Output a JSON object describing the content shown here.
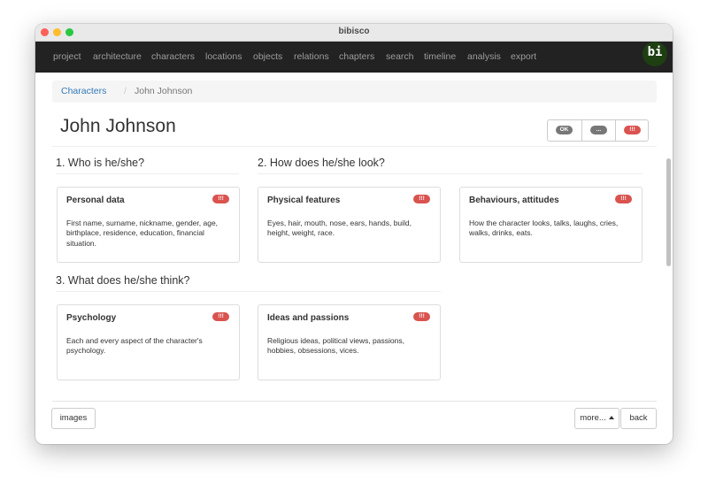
{
  "window": {
    "title": "bibisco"
  },
  "nav": {
    "items": [
      "project",
      "architecture",
      "characters",
      "locations",
      "objects",
      "relations",
      "chapters",
      "search",
      "timeline",
      "analysis",
      "export"
    ],
    "logo_text": "bi"
  },
  "breadcrumb": {
    "parent": "Characters",
    "separator": "/",
    "current": "John Johnson"
  },
  "page": {
    "title": "John Johnson"
  },
  "status_buttons": {
    "ok": "OK",
    "dots": "...",
    "danger": "!!!"
  },
  "sections": [
    {
      "heading": "1. Who is he/she?"
    },
    {
      "heading": "2. How does he/she look?"
    },
    {
      "heading": "3. What does he/she think?"
    }
  ],
  "cards": [
    {
      "title": "Personal data",
      "badge": "!!!",
      "description": "First name, surname, nickname, gender, age, birthplace, residence, education, financial situation."
    },
    {
      "title": "Physical features",
      "badge": "!!!",
      "description": "Eyes, hair, mouth, nose, ears, hands, build, height, weight, race."
    },
    {
      "title": "Behaviours, attitudes",
      "badge": "!!!",
      "description": "How the character looks, talks, laughs, cries, walks, drinks, eats."
    },
    {
      "title": "Psychology",
      "badge": "!!!",
      "description": "Each and every aspect of the character's psychology."
    },
    {
      "title": "Ideas and passions",
      "badge": "!!!",
      "description": "Religious ideas, political views, passions, hobbies, obsessions, vices."
    }
  ],
  "footer": {
    "images": "images",
    "more": "more...",
    "back": "back"
  },
  "colors": {
    "navbar": "#222222",
    "nav_text": "#9d9d9d",
    "link": "#337ab7",
    "danger": "#d9534f",
    "logo": "#1e3f12"
  }
}
